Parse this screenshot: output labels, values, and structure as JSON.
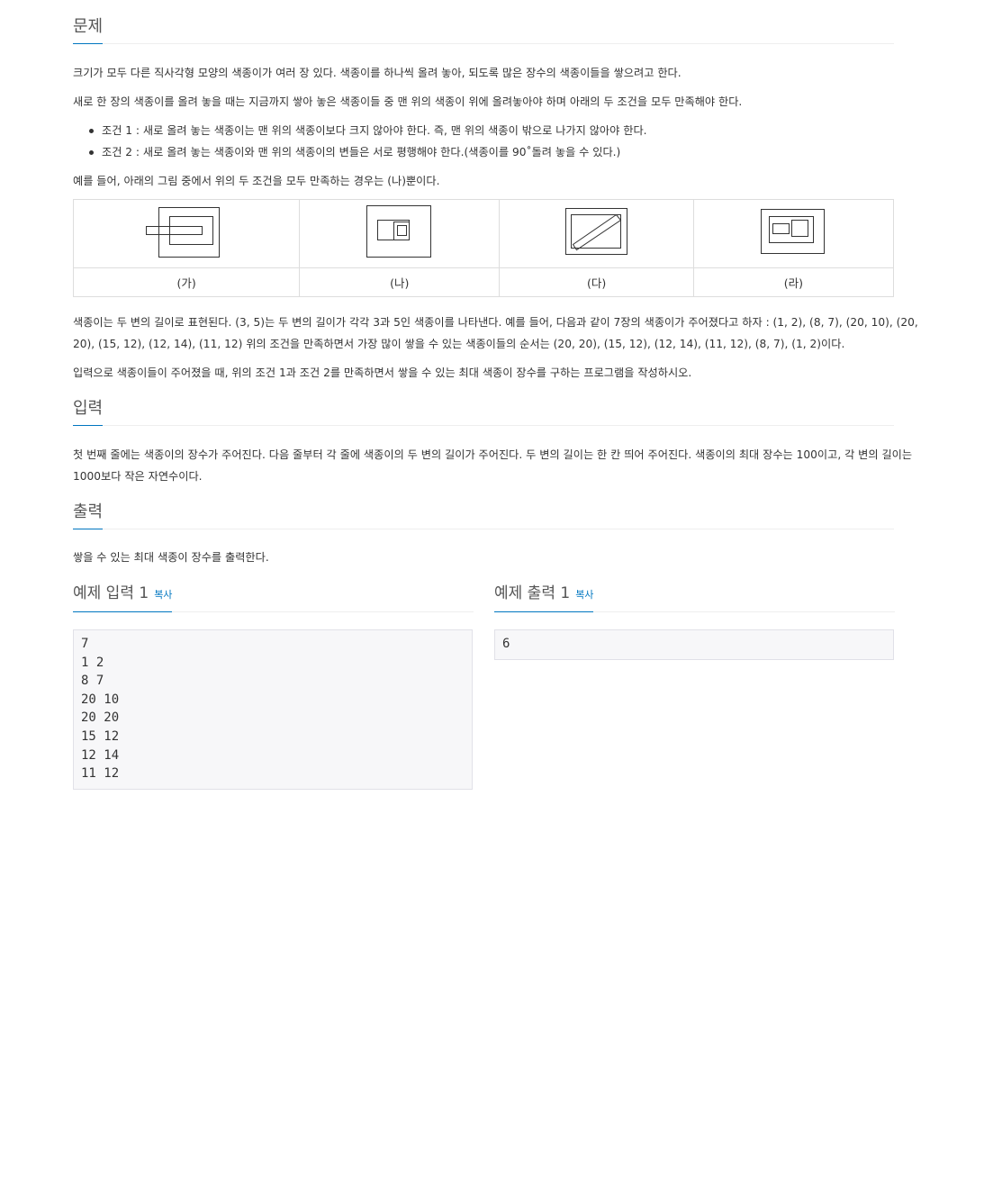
{
  "problem": {
    "title": "문제",
    "p1": "크기가 모두 다른 직사각형 모양의 색종이가 여러 장 있다. 색종이를 하나씩 올려 놓아, 되도록 많은 장수의 색종이들을 쌓으려고 한다.",
    "p2": "새로 한 장의 색종이를 올려 놓을 때는 지금까지 쌓아 놓은 색종이들 중 맨 위의 색종이 위에 올려놓아야 하며 아래의 두 조건을 모두 만족해야 한다.",
    "conditions": [
      "조건 1 : 새로 올려 놓는 색종이는 맨 위의 색종이보다 크지 않아야 한다. 즉, 맨 위의 색종이 밖으로 나가지 않아야 한다.",
      "조건 2 : 새로 올려 놓는 색종이와 맨 위의 색종이의 변들은 서로 평행해야 한다.(색종이를 90˚돌려 놓을 수 있다.)"
    ],
    "p3": "예를 들어, 아래의 그림 중에서 위의 두 조건을 모두 만족하는 경우는 (나)뿐이다.",
    "figure_captions": [
      "(가)",
      "(나)",
      "(다)",
      "(라)"
    ],
    "p4_line1": "색종이는 두 변의 길이로 표현된다. (3, 5)는 두 변의 길이가 각각 3과 5인 색종이를 나타낸다. 예를 들어, 다음과 같이 7장의 색종이가 주어졌다고 하자 : (1, 2), (8, 7), (20, 10), (20,",
    "p4_line2": "20), (15, 12), (12, 14), (11, 12) 위의 조건을 만족하면서 가장 많이 쌓을 수 있는 색종이들의 순서는 (20, 20), (15, 12), (12, 14), (11, 12), (8, 7), (1, 2)이다.",
    "p5": "입력으로 색종이들이 주어졌을 때, 위의 조건 1과 조건 2를 만족하면서 쌓을 수 있는 최대 색종이 장수를 구하는 프로그램을 작성하시오."
  },
  "input": {
    "title": "입력",
    "line1": "첫 번째 줄에는 색종이의 장수가 주어진다. 다음 줄부터 각 줄에 색종이의 두 변의 길이가 주어진다. 두 변의 길이는 한 칸 띄어 주어진다. 색종이의 최대 장수는 100이고, 각 변의 길이는",
    "line2": "1000보다 작은 자연수이다."
  },
  "output": {
    "title": "출력",
    "text": "쌓을 수 있는 최대 색종이 장수를 출력한다."
  },
  "sample_input": {
    "title": "예제 입력 1",
    "copy_label": "복사",
    "content": "7\n1 2\n8 7\n20 10\n20 20\n15 12\n12 14\n11 12"
  },
  "sample_output": {
    "title": "예제 출력 1",
    "copy_label": "복사",
    "content": "6"
  }
}
